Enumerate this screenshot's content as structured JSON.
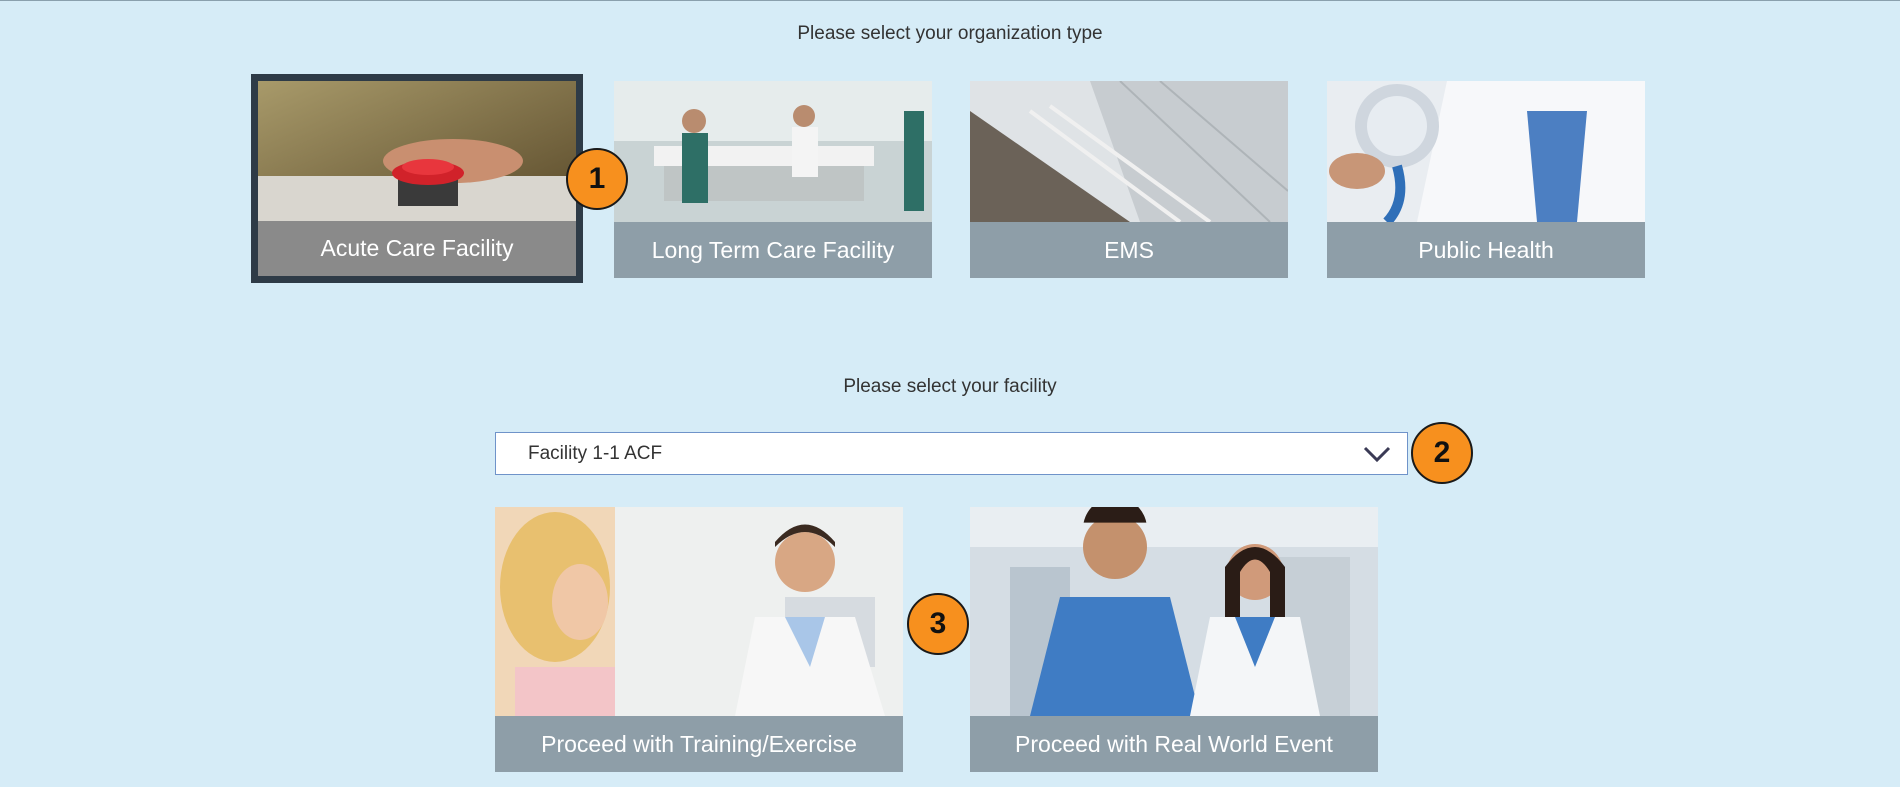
{
  "org": {
    "heading": "Please select your organization type",
    "types": [
      {
        "label": "Acute Care Facility",
        "selected": true
      },
      {
        "label": "Long Term Care Facility",
        "selected": false
      },
      {
        "label": "EMS",
        "selected": false
      },
      {
        "label": "Public Health",
        "selected": false
      }
    ]
  },
  "facility": {
    "heading": "Please select your facility",
    "selected_value": "Facility 1-1 ACF"
  },
  "proceed": {
    "training_label": "Proceed with Training/Exercise",
    "real_world_label": "Proceed with Real World Event"
  },
  "callouts": [
    "1",
    "2",
    "3"
  ],
  "colors": {
    "background": "#d6ecf7",
    "card_label": "#8e9ea8",
    "selected_border": "#2e3b47",
    "callout": "#f7901e"
  }
}
